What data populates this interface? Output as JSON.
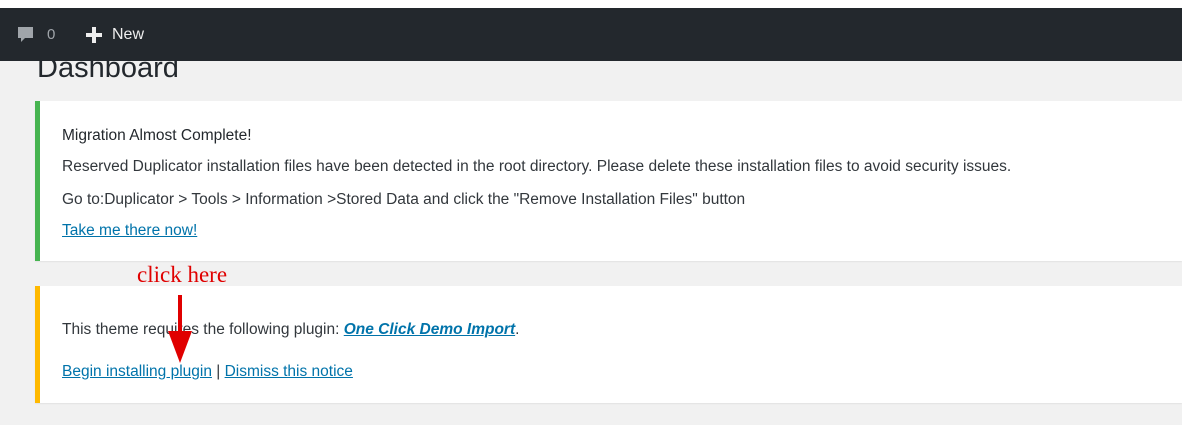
{
  "admin_bar": {
    "comments_icon": "comment-bubble-icon",
    "comments_count": "0",
    "new_icon": "plus-icon",
    "new_label": "New"
  },
  "page": {
    "title": "Dashboard"
  },
  "notices": {
    "migration": {
      "accent_color": "#46b450",
      "heading": "Migration Almost Complete!",
      "message": "Reserved Duplicator installation files have been detected in the root directory. Please delete these installation files to avoid security issues.",
      "instructions": "Go to:Duplicator > Tools > Information >Stored Data and click the \"Remove Installation Files\" button",
      "link_label": "Take me there now!"
    },
    "plugin": {
      "accent_color": "#ffb900",
      "message_prefix": "This theme requires the following plugin: ",
      "plugin_link": "One Click Demo Import",
      "message_suffix": ".",
      "begin_label": "Begin installing plugin",
      "separator": " | ",
      "dismiss_label": "Dismiss this notice"
    }
  },
  "annotation": {
    "text": "click here",
    "color": "#e00000",
    "arrow_icon": "down-arrow-icon"
  }
}
